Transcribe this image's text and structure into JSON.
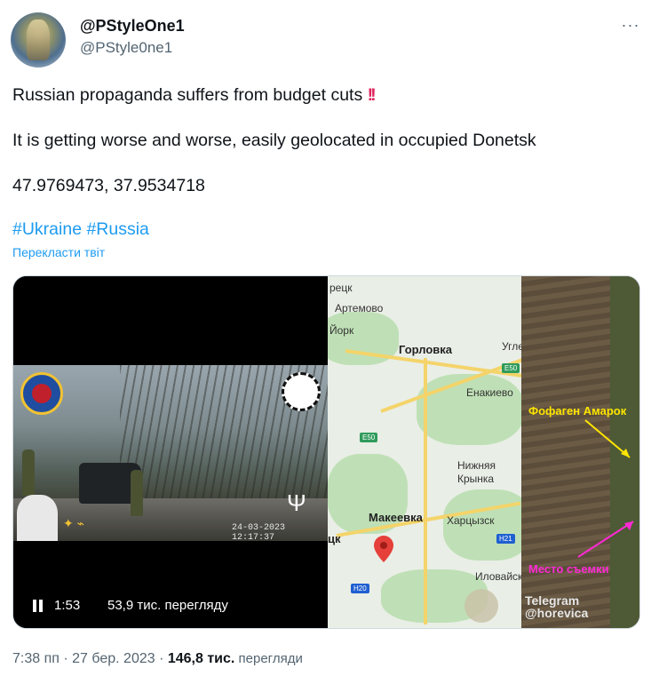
{
  "user": {
    "display_name": "@PStyleOne1",
    "handle": "@PStyle0ne1"
  },
  "tweet": {
    "line1": "Russian propaganda suffers from budget cuts",
    "line1_emoji": "‼️",
    "line2": "It is getting worse and worse, easily geolocated in occupied Donetsk",
    "line3": "47.9769473, 37.9534718",
    "hashtags": "#Ukraine #Russia",
    "translate_link": "Перекласти твіт"
  },
  "video": {
    "time": "1:53",
    "views": "53,9 тис. перегляду",
    "timestamp": "24-03-2023 12:17:37"
  },
  "map": {
    "labels": [
      "рецк",
      "Артемово",
      "Йорк",
      "Горловка",
      "Углег",
      "Енакиево",
      "Нижняя",
      "Крынка",
      "Макеевка",
      "Харцызск",
      "цк",
      "Иловайск"
    ],
    "highways": [
      "E50",
      "E50",
      "H21",
      "H20"
    ]
  },
  "satellite": {
    "label1": "Фофаген Амарок",
    "label2": "Место съемки",
    "telegram": "Telegram",
    "telegram_handle": "@horevica"
  },
  "footer": {
    "time": "7:38 пп · 27 бер. 2023 · ",
    "views_count": "146,8 тис.",
    "views_label": " перегляди"
  },
  "icons": [
    "more-icon",
    "pause-icon",
    "map-pin-icon"
  ]
}
